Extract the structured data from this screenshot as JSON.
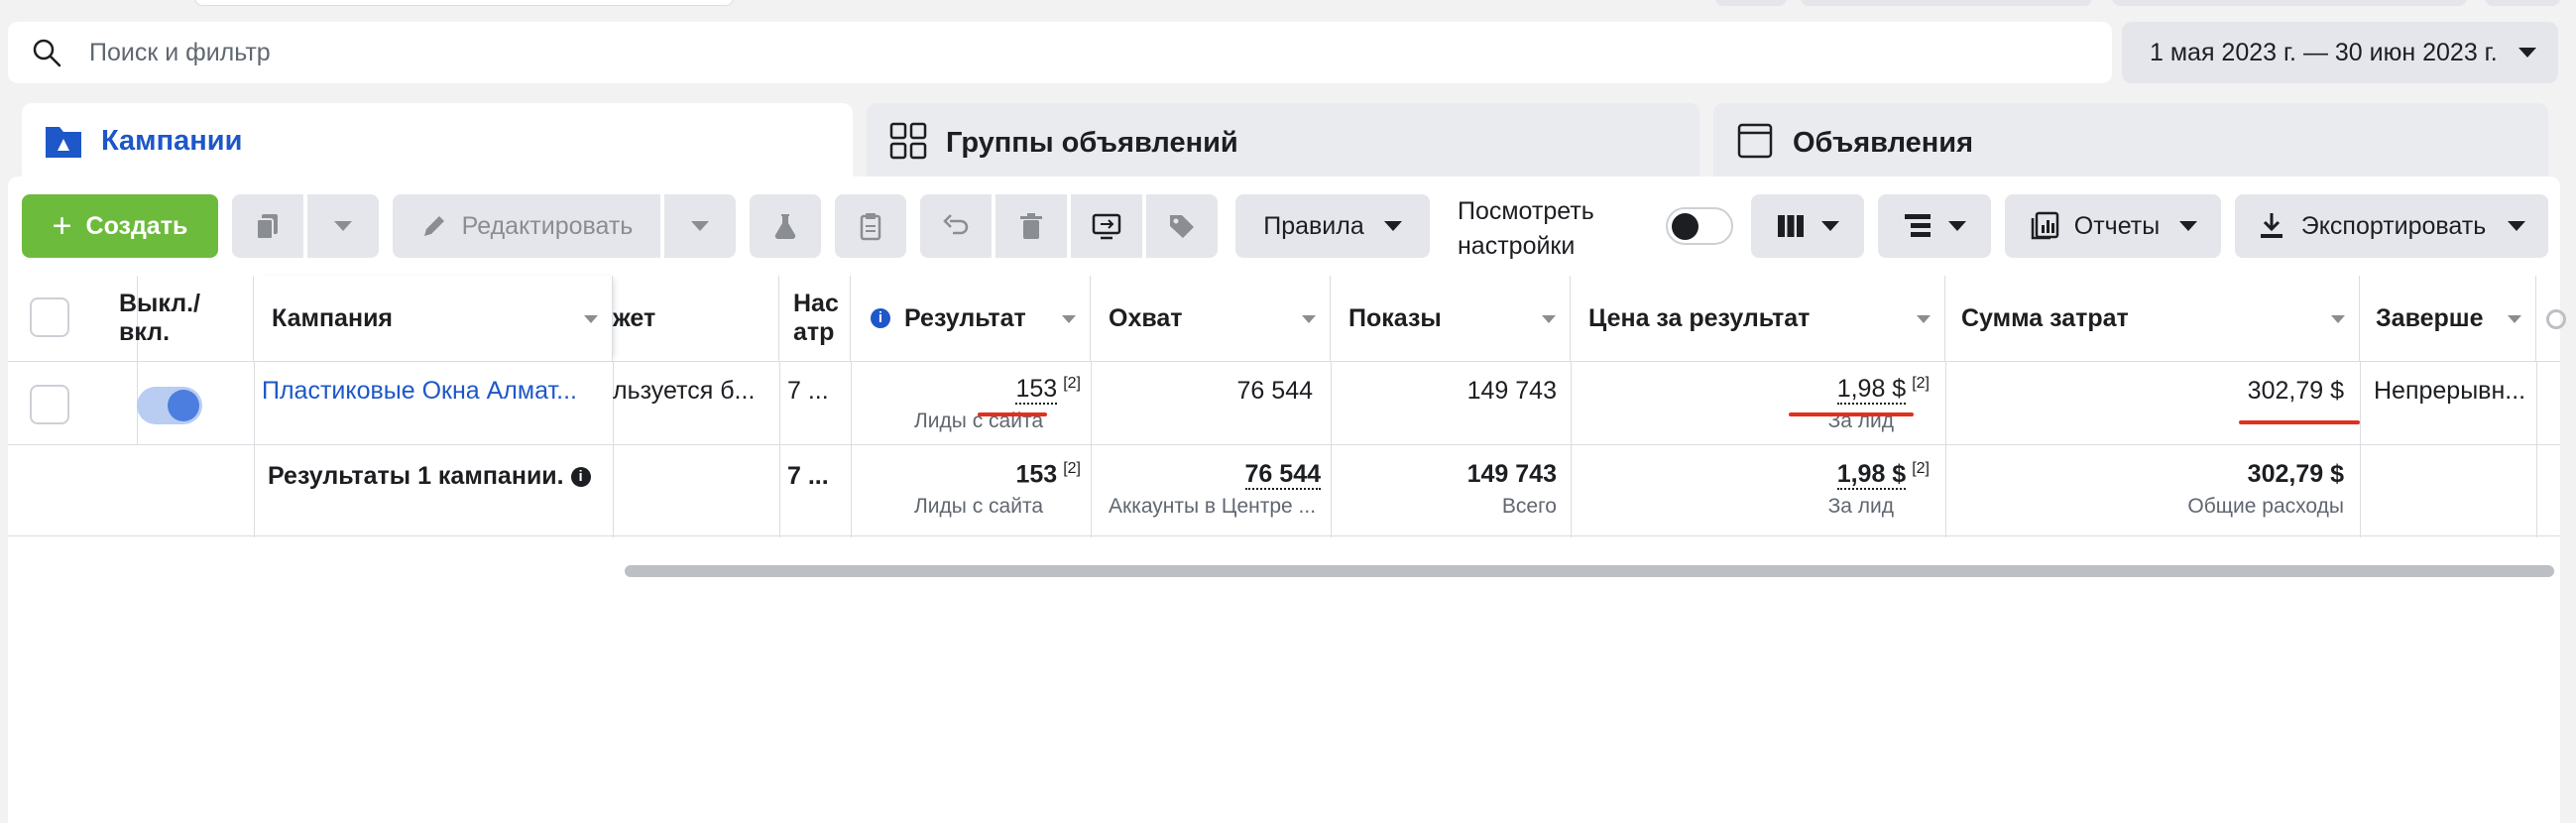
{
  "search": {
    "placeholder": "Поиск и фильтр"
  },
  "date_range": {
    "label": "1 мая 2023 г. — 30 июн 2023 г."
  },
  "tabs": [
    {
      "label": "Кампании",
      "active": true
    },
    {
      "label": "Группы объявлений",
      "active": false
    },
    {
      "label": "Объявления",
      "active": false
    }
  ],
  "toolbar": {
    "create_label": "Создать",
    "edit_label": "Редактировать",
    "rules_label": "Правила",
    "view_settings_line1": "Посмотреть",
    "view_settings_line2": "настройки",
    "reports_label": "Отчеты",
    "export_label": "Экспортировать"
  },
  "table": {
    "headers": {
      "toggle": "Выкл./ вкл.",
      "campaign": "Кампания",
      "budget": "жет",
      "attribution": "Нас атр",
      "result": "Результат",
      "reach": "Охват",
      "impressions": "Показы",
      "cost_per_result": "Цена за результат",
      "amount_spent": "Сумма затрат",
      "ends": "Заверше"
    },
    "row": {
      "campaign": "Пластиковые Окна Алмат...",
      "budget": "льзуется б...",
      "attribution": "7 ...",
      "result": "153",
      "result_sup": "[2]",
      "result_sub": "Лиды с сайта",
      "reach": "76 544",
      "impressions": "149 743",
      "cost_per_result": "1,98 $",
      "cost_sup": "[2]",
      "cost_sub": "За лид",
      "amount_spent": "302,79 $",
      "ends": "Непрерывн..."
    },
    "totals": {
      "label": "Результаты 1 кампании.",
      "attribution": "7 ...",
      "result": "153",
      "result_sup": "[2]",
      "result_sub": "Лиды с сайта",
      "reach": "76 544",
      "reach_sub": "Аккаунты в Центре ...",
      "impressions": "149 743",
      "impressions_sub": "Всего",
      "cost_per_result": "1,98 $",
      "cost_sup": "[2]",
      "cost_sub": "За лид",
      "amount_spent": "302,79 $",
      "amount_sub": "Общие расходы"
    }
  },
  "colors": {
    "accent": "#1d57c8",
    "create": "#6dbb3c",
    "highlight": "#e0301e"
  }
}
